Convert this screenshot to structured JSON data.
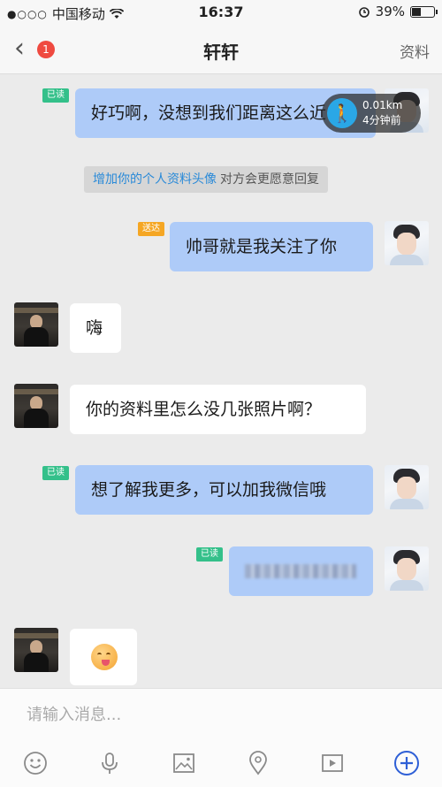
{
  "status": {
    "carrier": "中国移动",
    "time": "16:37",
    "battery": "39%",
    "battery_level": 0.39
  },
  "header": {
    "back_badge": "1",
    "title": "轩轩",
    "profile_label": "资料"
  },
  "distance": {
    "km": "0.01km",
    "ago": "4分钟前"
  },
  "hint": {
    "link": "增加你的个人资料头像",
    "rest": "对方会更愿意回复"
  },
  "messages": [
    {
      "side": "out",
      "status": "已读",
      "text": "好巧啊，没想到我们距离这么近"
    },
    {
      "side": "out",
      "status": "送达",
      "text": "帅哥就是我关注了你"
    },
    {
      "side": "in",
      "text": "嗨"
    },
    {
      "side": "in",
      "text": "你的资料里怎么没几张照片啊？"
    },
    {
      "side": "out",
      "status": "已读",
      "text": "想了解我更多，可以加我微信哦"
    },
    {
      "side": "out",
      "status": "已读",
      "text": ""
    },
    {
      "side": "in",
      "text": "",
      "emoji": "yum-emoji"
    }
  ],
  "input": {
    "placeholder": "请输入消息..."
  },
  "toolbar": [
    "emoji-icon",
    "microphone-icon",
    "image-icon",
    "location-icon",
    "video-icon",
    "plus-icon"
  ],
  "colors": {
    "outgoing_bubble": "#aecbf8",
    "read_tag": "#34c08a",
    "sent_tag": "#f5a623",
    "link": "#2a8ad8",
    "accent": "#2e5fd6"
  }
}
